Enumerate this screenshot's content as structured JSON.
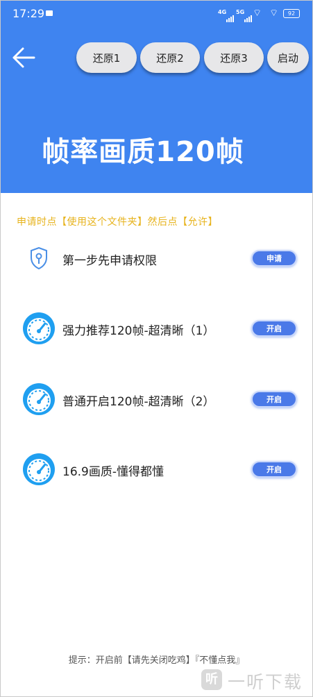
{
  "status_bar": {
    "time": "17:29",
    "net1": "4G",
    "net2": "5G",
    "battery": "92"
  },
  "toolbar": {
    "buttons": [
      {
        "label": "还原1"
      },
      {
        "label": "还原2"
      },
      {
        "label": "还原3"
      },
      {
        "label": "启动"
      }
    ]
  },
  "header": {
    "title": "帧率画质120帧"
  },
  "notice": "申请时点【使用这个文件夹】然后点【允许】",
  "items": [
    {
      "label": "第一步先申请权限",
      "action": "申请",
      "icon": "shield-key-icon"
    },
    {
      "label": "强力推荐120帧-超清晰（1）",
      "action": "开启",
      "icon": "speedometer-icon"
    },
    {
      "label": "普通开启120帧-超清晰（2）",
      "action": "开启",
      "icon": "speedometer-icon"
    },
    {
      "label": "16.9画质-懂得都懂",
      "action": "开启",
      "icon": "speedometer-icon"
    }
  ],
  "footer": {
    "tip": "提示：开启前【请先关闭吃鸡】『不懂点我』"
  },
  "watermark": {
    "mark": "听",
    "text": "一听下载"
  },
  "colors": {
    "header": "#3f84f0",
    "accent_button": "#4a79e8",
    "notice": "#e7b31c"
  }
}
